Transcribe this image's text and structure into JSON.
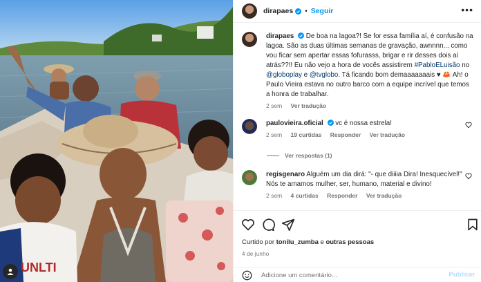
{
  "post": {
    "username": "dirapaes",
    "dot": "•",
    "follow_label": "Seguir",
    "more_label": "•••"
  },
  "caption": {
    "username": "dirapaes",
    "text_1": "De boa na lagoa?! Se for essa família aí, é confusão na lagoa. São as duas últimas semanas de gravação, awnnnn... como vou ficar sem apertar essas fofurasss, brigar e rir desses dois aí atrás??!! Eu não vejo a hora de vocês assistirem",
    "hashtag": "#PabloELuisão",
    "text_2": "no",
    "mention_1": "@globoplay",
    "text_3": "e",
    "mention_2": "@tvglobo",
    "text_4": ". Tá ficando bom demaaaaaaais ♥ 🦀 Ah! o Paulo Vieira estava no outro barco com a equipe incrível que temos a honra de trabalhar.",
    "time": "2 sem",
    "translate": "Ver tradução"
  },
  "comments": [
    {
      "username": "paulovieira.oficial",
      "text": "vc é nossa estrela!",
      "time": "2 sem",
      "likes": "19 curtidas",
      "reply": "Responder",
      "translate": "Ver tradução",
      "replies": "Ver respostas (1)"
    },
    {
      "username": "regisgenaro",
      "text": "Alguém um dia dirá: \"- que diiiia Dira! Inesquecível!\" Nós te amamos mulher, ser, humano, material e divino!",
      "time": "2 sem",
      "likes": "4 curtidas",
      "reply": "Responder",
      "translate": "Ver tradução"
    }
  ],
  "footer": {
    "liked_prefix": "Curtido por",
    "liked_user": "tonilu_zumba",
    "liked_suffix": "e",
    "liked_others": "outras pessoas",
    "date": "4 de junho",
    "comment_placeholder": "Adicione um comentário...",
    "publish_label": "Publicar"
  },
  "photo": {
    "shirt_text": "UNLTI"
  },
  "colors": {
    "accent": "#0095f6",
    "link": "#00376b",
    "muted": "#737373",
    "publish_disabled": "#b3dbff"
  }
}
